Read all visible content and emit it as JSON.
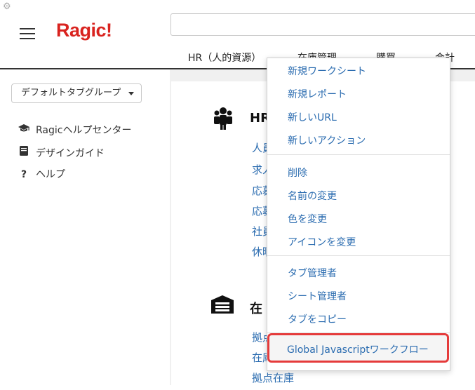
{
  "app": {
    "logo": "Ragic!"
  },
  "header": {
    "tabs": [
      {
        "label": "HR（人的資源）"
      },
      {
        "label": "在庫管理"
      },
      {
        "label": "購買"
      },
      {
        "label": "会計"
      }
    ]
  },
  "sidebar": {
    "tabgroup_label": "デフォルトタブグループ",
    "links": [
      {
        "label": "Ragicヘルプセンター",
        "icon": "graduation-cap-icon"
      },
      {
        "label": "デザインガイド",
        "icon": "book-icon"
      },
      {
        "label": "ヘルプ",
        "icon": "question-icon"
      }
    ]
  },
  "main": {
    "sections": [
      {
        "title": "HR",
        "icon": "people-icon",
        "links": [
          "人員",
          "求人",
          "応募",
          "応募",
          "社員",
          "休暇"
        ]
      },
      {
        "title": "在",
        "icon": "warehouse-icon",
        "links": [
          "拠点",
          "在庫",
          "拠点在庫"
        ]
      }
    ]
  },
  "context_menu": {
    "groups": [
      [
        "新規ワークシート",
        "新規レポート",
        "新しいURL",
        "新しいアクション"
      ],
      [
        "削除",
        "名前の変更",
        "色を変更",
        "アイコンを変更"
      ],
      [
        "タブ管理者",
        "シート管理者",
        "タブをコピー"
      ],
      [
        "Global Javascriptワークフロー"
      ]
    ]
  },
  "colors": {
    "brand": "#d9231f",
    "link": "#2b6cb0",
    "highlight": "#e53b3b"
  }
}
